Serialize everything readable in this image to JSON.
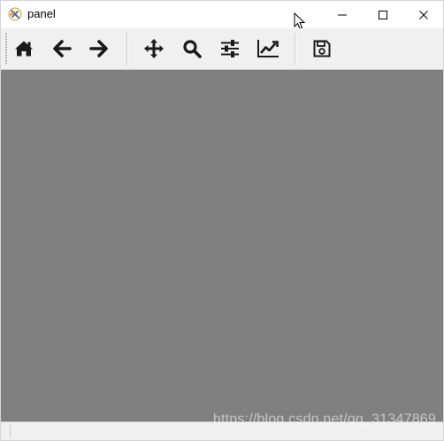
{
  "window": {
    "title": "panel"
  },
  "title_controls": {
    "minimize_icon": "minimize-icon",
    "maximize_icon": "maximize-icon",
    "close_icon": "close-icon"
  },
  "toolbar": {
    "tools": [
      {
        "name": "home",
        "icon": "home-icon"
      },
      {
        "name": "back",
        "icon": "arrow-left-icon"
      },
      {
        "name": "forward",
        "icon": "arrow-right-icon"
      },
      {
        "name": "pan",
        "icon": "move-icon"
      },
      {
        "name": "zoom",
        "icon": "search-icon"
      },
      {
        "name": "subplots",
        "icon": "sliders-icon"
      },
      {
        "name": "customize",
        "icon": "line-chart-icon"
      },
      {
        "name": "save",
        "icon": "floppy-disk-icon"
      }
    ]
  },
  "canvas": {
    "background": "#808080"
  },
  "watermark": {
    "text": "https://blog.csdn.net/qq_31347869"
  },
  "colors": {
    "toolbar_bg": "#f0f0f0",
    "canvas_bg": "#808080",
    "icon": "#1a1a1a"
  }
}
